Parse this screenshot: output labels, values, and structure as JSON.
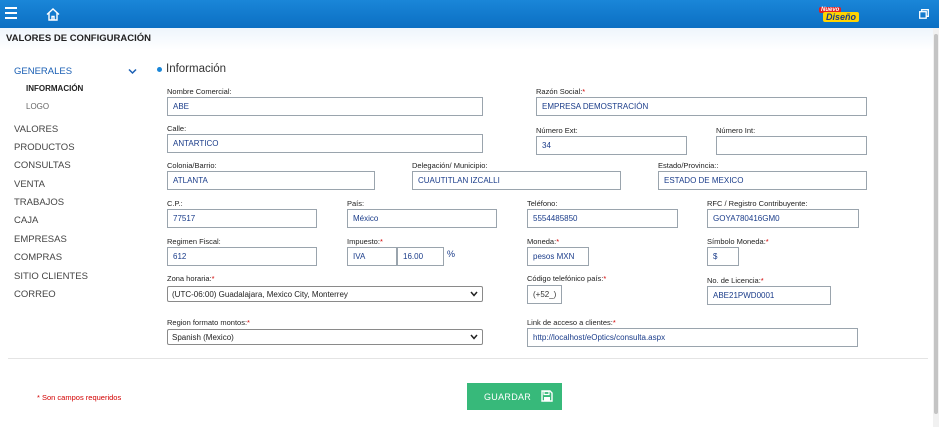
{
  "topbar": {
    "logo_top": "Nuevo",
    "logo_bottom": "Diseño"
  },
  "page_title": "VALORES DE CONFIGURACIÓN",
  "sidebar": {
    "generales": "GENERALES",
    "sub_items": [
      "INFORMACIÓN",
      "LOGO"
    ],
    "items": [
      "VALORES",
      "PRODUCTOS",
      "CONSULTAS",
      "VENTA",
      "TRABAJOS",
      "CAJA",
      "EMPRESAS",
      "COMPRAS",
      "SITIO CLIENTES",
      "CORREO"
    ]
  },
  "section_title": "Información",
  "form": {
    "nombre_comercial": {
      "label": "Nombre Comercial:",
      "value": "ABE"
    },
    "razon_social": {
      "label": "Razón Social:",
      "value": "EMPRESA DEMOSTRACIÓN"
    },
    "calle": {
      "label": "Calle:",
      "value": "ANTARTICO"
    },
    "numero_ext": {
      "label": "Número Ext:",
      "value": "34"
    },
    "numero_int": {
      "label": "Número Int:",
      "value": ""
    },
    "colonia": {
      "label": "Colonia/Barrio:",
      "value": "ATLANTA"
    },
    "delegacion": {
      "label": "Delegación/ Municipio:",
      "value": "CUAUTITLAN IZCALLI"
    },
    "estado": {
      "label": "Estado/Provincia::",
      "value": "ESTADO DE MEXICO"
    },
    "cp": {
      "label": "C.P.:",
      "value": "77517"
    },
    "pais": {
      "label": "País:",
      "value": "México"
    },
    "telefono": {
      "label": "Teléfono:",
      "value": "5554485850"
    },
    "rfc": {
      "label": "RFC / Registro Contribuyente:",
      "value": "GOYA780416GM0"
    },
    "regimen": {
      "label": "Regimen Fiscal:",
      "value": "612"
    },
    "impuesto": {
      "label": "Impuesto:",
      "name": "IVA",
      "rate": "16.00",
      "unit": "%"
    },
    "moneda": {
      "label": "Moneda:",
      "value": "pesos MXN"
    },
    "simbolo": {
      "label": "Símbolo Moneda:",
      "value": "$"
    },
    "zona": {
      "label": "Zona horaria:",
      "value": "(UTC-06:00) Guadalajara, Mexico City, Monterrey"
    },
    "codigo_tel": {
      "label": "Código telefónico país:",
      "value": "(+52_)"
    },
    "licencia": {
      "label": "No. de Licencia:",
      "value": "ABE21PWD0001"
    },
    "region": {
      "label": "Region formato montos:",
      "value": "Spanish (Mexico)"
    },
    "link": {
      "label": "Link de acceso a clientes:",
      "value": "http://localhost/eOptics/consulta.aspx"
    },
    "required_mark": "*"
  },
  "required_note": "* Son campos requeridos",
  "save_button": "GUARDAR",
  "colors": {
    "topbar": "#0b6fc3",
    "save": "#37b97a",
    "required": "#d20000"
  }
}
